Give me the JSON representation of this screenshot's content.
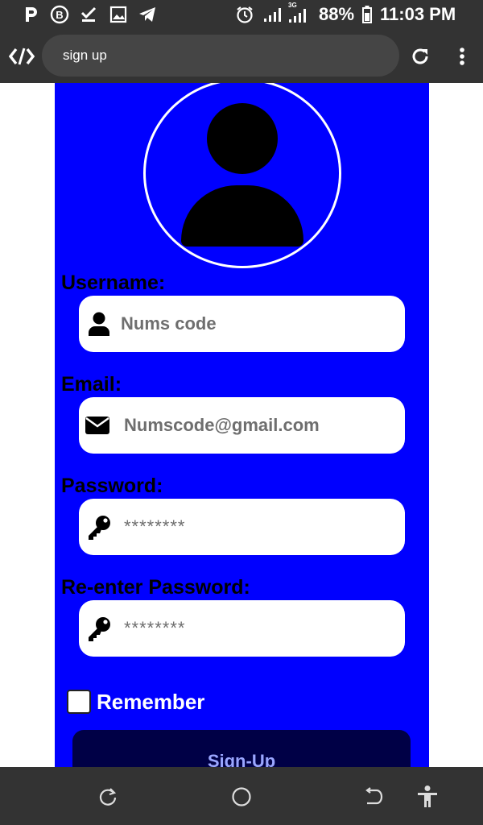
{
  "status_bar": {
    "battery": "88%",
    "time": "11:03 PM",
    "network_type": "3G",
    "icons": [
      "p-icon",
      "b-circle-icon",
      "download-done-icon",
      "image-icon",
      "telegram-icon",
      "alarm-icon",
      "signal-icon",
      "signal-3g-icon",
      "battery-icon"
    ]
  },
  "browser": {
    "url": "sign up",
    "icons": [
      "code-app-icon",
      "reload-icon",
      "more-vert-icon"
    ]
  },
  "form": {
    "username": {
      "label": "Username:",
      "value": "Nums code",
      "icon": "user-icon"
    },
    "email": {
      "label": "Email:",
      "value": "Numscode@gmail.com",
      "icon": "mail-icon"
    },
    "password": {
      "label": "Password:",
      "value": "********",
      "icon": "key-icon"
    },
    "repassword": {
      "label": "Re-enter Password:",
      "value": "********",
      "icon": "key-icon"
    },
    "remember_label": "Remember",
    "remember_checked": false,
    "signup_label": "Sign-Up"
  },
  "nav_bar": {
    "icons": [
      "recent-apps-icon",
      "home-icon",
      "back-icon",
      "accessibility-icon"
    ]
  },
  "colors": {
    "panel": "#0000ff",
    "bars": "#333333",
    "button": "#000046",
    "button_text": "#9aa6ff"
  }
}
